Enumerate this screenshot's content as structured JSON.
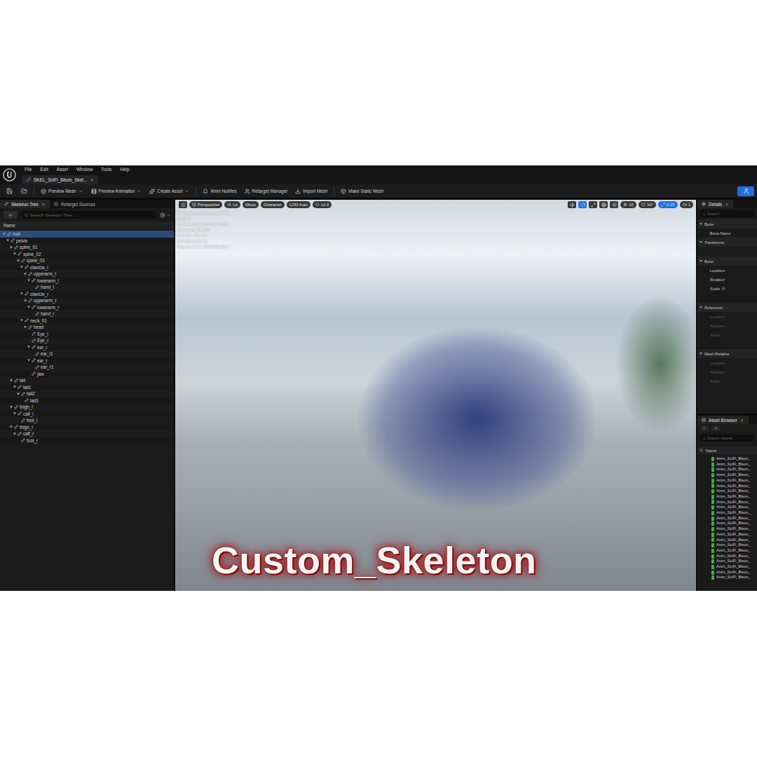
{
  "menu": [
    "File",
    "Edit",
    "Asset",
    "Window",
    "Tools",
    "Help"
  ],
  "document_tab": {
    "label": "SKEL_SciFi_Bison_Skel...",
    "close": "×",
    "selected": true
  },
  "toolbar": [
    {
      "label": "Preview Mesh",
      "dropdown": true
    },
    {
      "label": "Preview Animation",
      "dropdown": true
    },
    {
      "label": "Create Asset",
      "dropdown": true
    },
    {
      "label": "Anim Notifies",
      "dropdown": false
    },
    {
      "label": "Retarget Manager",
      "dropdown": false
    },
    {
      "label": "Import Mesh",
      "dropdown": false
    },
    {
      "label": "Make Static Mesh",
      "dropdown": false
    }
  ],
  "skeleton_panel": {
    "close": "×",
    "tabs": [
      {
        "label": "Skeleton Tree",
        "selected": true,
        "closable": true
      },
      {
        "label": "Retarget Sources",
        "selected": false,
        "closable": false
      }
    ],
    "search": {
      "placeholder": "Search Skeleton Tree..."
    },
    "header": "Name",
    "bones": [
      {
        "name": "root",
        "depth": 0,
        "expanded": true,
        "selected": true
      },
      {
        "name": "pelvis",
        "depth": 1,
        "expanded": true,
        "selected": false
      },
      {
        "name": "spine_01",
        "depth": 2,
        "expanded": true,
        "selected": false
      },
      {
        "name": "spine_02",
        "depth": 3,
        "expanded": true,
        "selected": false
      },
      {
        "name": "spine_03",
        "depth": 4,
        "expanded": true,
        "selected": false
      },
      {
        "name": "clavicle_l",
        "depth": 5,
        "expanded": true,
        "selected": false
      },
      {
        "name": "upperarm_l",
        "depth": 6,
        "expanded": true,
        "selected": false
      },
      {
        "name": "lowerarm_l",
        "depth": 7,
        "expanded": true,
        "selected": false
      },
      {
        "name": "hand_l",
        "depth": 8,
        "expanded": false,
        "selected": false
      },
      {
        "name": "clavicle_r",
        "depth": 5,
        "expanded": true,
        "selected": false
      },
      {
        "name": "upperarm_r",
        "depth": 6,
        "expanded": true,
        "selected": false
      },
      {
        "name": "lowerarm_r",
        "depth": 7,
        "expanded": true,
        "selected": false
      },
      {
        "name": "hand_r",
        "depth": 8,
        "expanded": false,
        "selected": false
      },
      {
        "name": "neck_01",
        "depth": 5,
        "expanded": true,
        "selected": false
      },
      {
        "name": "head",
        "depth": 6,
        "expanded": true,
        "selected": false
      },
      {
        "name": "Eye_l",
        "depth": 7,
        "expanded": false,
        "selected": false
      },
      {
        "name": "Eye_r",
        "depth": 7,
        "expanded": false,
        "selected": false
      },
      {
        "name": "ear_l",
        "depth": 7,
        "expanded": true,
        "selected": false
      },
      {
        "name": "ear_l1",
        "depth": 8,
        "expanded": false,
        "selected": false
      },
      {
        "name": "ear_r",
        "depth": 7,
        "expanded": true,
        "selected": false
      },
      {
        "name": "ear_r1",
        "depth": 8,
        "expanded": false,
        "selected": false
      },
      {
        "name": "jaw",
        "depth": 7,
        "expanded": false,
        "selected": false
      },
      {
        "name": "tail",
        "depth": 2,
        "expanded": true,
        "selected": false
      },
      {
        "name": "tail1",
        "depth": 3,
        "expanded": true,
        "selected": false
      },
      {
        "name": "tail2",
        "depth": 4,
        "expanded": true,
        "selected": false
      },
      {
        "name": "tail3",
        "depth": 5,
        "expanded": false,
        "selected": false
      },
      {
        "name": "thigh_l",
        "depth": 2,
        "expanded": true,
        "selected": false
      },
      {
        "name": "calf_l",
        "depth": 3,
        "expanded": true,
        "selected": false
      },
      {
        "name": "foot_l",
        "depth": 4,
        "expanded": false,
        "selected": false
      },
      {
        "name": "thigh_r",
        "depth": 2,
        "expanded": true,
        "selected": false
      },
      {
        "name": "calf_r",
        "depth": 3,
        "expanded": true,
        "selected": false
      },
      {
        "name": "foot_r",
        "depth": 4,
        "expanded": false,
        "selected": false
      }
    ]
  },
  "viewport": {
    "left_buttons": [
      "Perspective",
      "Lit",
      "Show",
      "Character",
      "LOD Auto",
      "x1.0"
    ],
    "tool_buttons": [
      {
        "active": false
      },
      {
        "active": true
      },
      {
        "active": false
      },
      {
        "active": false
      },
      {
        "active": false
      }
    ],
    "snap_buttons": [
      {
        "label": "10",
        "active": false
      },
      {
        "label": "10°",
        "active": false
      },
      {
        "label": "0.25",
        "active": true
      },
      {
        "label": "1",
        "active": false
      }
    ],
    "info": [
      "Previewing Reference Pose",
      "LOD: 0",
      "Current Screen Size: 1.158",
      "Triangles: 54,310",
      "Vertices: 31,220",
      "UV Channels: 1",
      "Approx Size: 135x305x224"
    ],
    "caption": "Custom_Skeleton"
  },
  "details": {
    "title": "Details",
    "close": "×",
    "search": {
      "placeholder": "Search"
    },
    "rows": [
      {
        "kind": "section",
        "label": "Bone",
        "disabled": false,
        "locked": false
      },
      {
        "kind": "field",
        "label": "Bone Name",
        "disabled": false,
        "locked": false
      },
      {
        "kind": "section",
        "label": "Transforms",
        "disabled": false,
        "locked": false
      },
      {
        "kind": "subsection",
        "label": "Bone",
        "disabled": false,
        "locked": false
      },
      {
        "kind": "field",
        "label": "Location",
        "disabled": false,
        "locked": false
      },
      {
        "kind": "field",
        "label": "Rotation",
        "disabled": false,
        "locked": false
      },
      {
        "kind": "field",
        "label": "Scale",
        "disabled": false,
        "locked": true
      },
      {
        "kind": "subsection",
        "label": "Reference",
        "disabled": false,
        "locked": false
      },
      {
        "kind": "field",
        "label": "Location",
        "disabled": true,
        "locked": false
      },
      {
        "kind": "field",
        "label": "Rotation",
        "disabled": true,
        "locked": false
      },
      {
        "kind": "field",
        "label": "Scale",
        "disabled": true,
        "locked": false
      },
      {
        "kind": "subsection",
        "label": "Mesh Relative",
        "disabled": false,
        "locked": false
      },
      {
        "kind": "field",
        "label": "Location",
        "disabled": true,
        "locked": false
      },
      {
        "kind": "field",
        "label": "Rotation",
        "disabled": true,
        "locked": false
      },
      {
        "kind": "field",
        "label": "Scale",
        "disabled": true,
        "locked": false
      }
    ]
  },
  "asset_browser": {
    "title": "Asset Browser",
    "close": "×",
    "search": {
      "placeholder": "Search Assets"
    },
    "header": "Name",
    "items": [
      "Anim_SciFi_Bison_",
      "Anim_SciFi_Bison_",
      "Anim_SciFi_Bison_",
      "Anim_SciFi_Bison_",
      "Anim_SciFi_Bison_",
      "Anim_SciFi_Bison_",
      "Anim_SciFi_Bison_",
      "Anim_SciFi_Bison_",
      "Anim_SciFi_Bison_",
      "Anim_SciFi_Bison_",
      "Anim_SciFi_Bison_",
      "Anim_SciFi_Bison_",
      "Anim_SciFi_Bison_",
      "Anim_SciFi_Bison_",
      "Anim_SciFi_Bison_",
      "Anim_SciFi_Bison_",
      "Anim_SciFi_Bison_",
      "Anim_SciFi_Bison_",
      "Anim_SciFi_Bison_",
      "Anim_SciFi_Bison_",
      "Anim_SciFi_Bison_",
      "Anim_SciFi_Bison_",
      "Anim_SciFi_Bison_"
    ]
  }
}
